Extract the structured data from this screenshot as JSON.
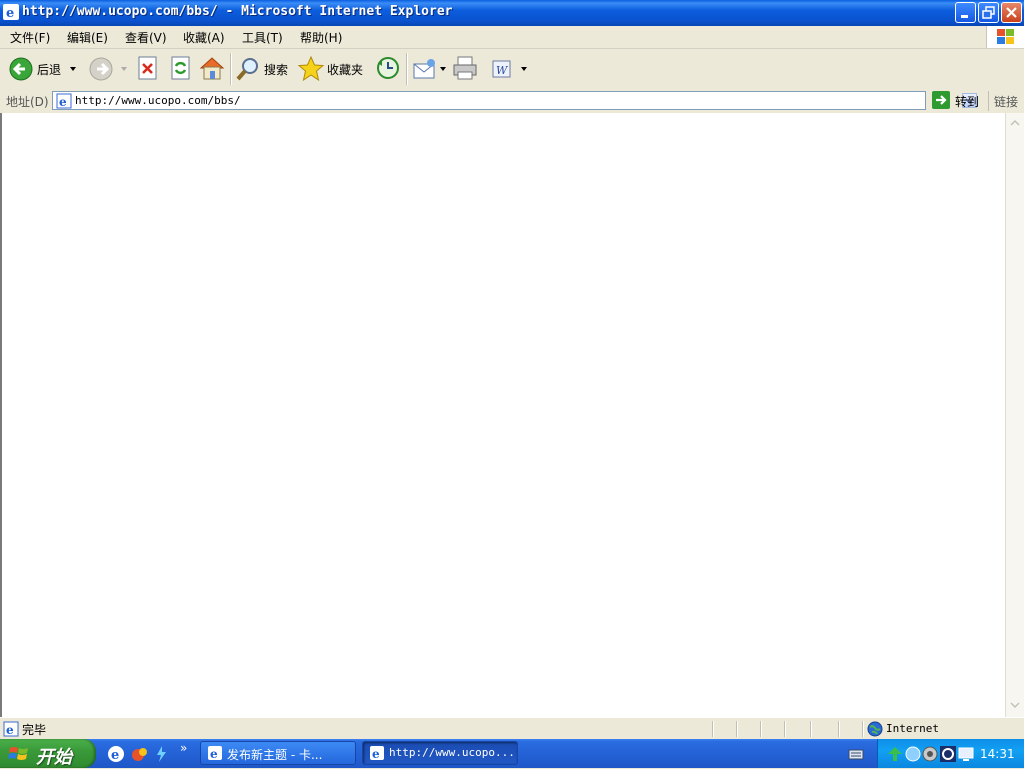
{
  "window": {
    "title": "http://www.ucopo.com/bbs/ - Microsoft Internet Explorer"
  },
  "menu": [
    {
      "label": "文件(F)"
    },
    {
      "label": "编辑(E)"
    },
    {
      "label": "查看(V)"
    },
    {
      "label": "收藏(A)"
    },
    {
      "label": "工具(T)"
    },
    {
      "label": "帮助(H)"
    }
  ],
  "toolbar": {
    "back_label": "后退",
    "search_label": "搜索",
    "favorites_label": "收藏夹"
  },
  "address": {
    "label": "地址(D)",
    "value": "http://www.ucopo.com/bbs/",
    "go_label": "转到",
    "links_label": "链接"
  },
  "status": {
    "text": "完毕",
    "zone": "Internet"
  },
  "taskbar": {
    "start_label": "开始",
    "tasks": [
      {
        "label": "发布新主题 - 卡..."
      },
      {
        "label": "http://www.ucopo..."
      }
    ],
    "clock": "14:31"
  },
  "colors": {
    "titlebar": "#0a5fe0",
    "taskbar": "#2462d6",
    "start_button": "#3a9a3a",
    "tray": "#12a0f2"
  }
}
